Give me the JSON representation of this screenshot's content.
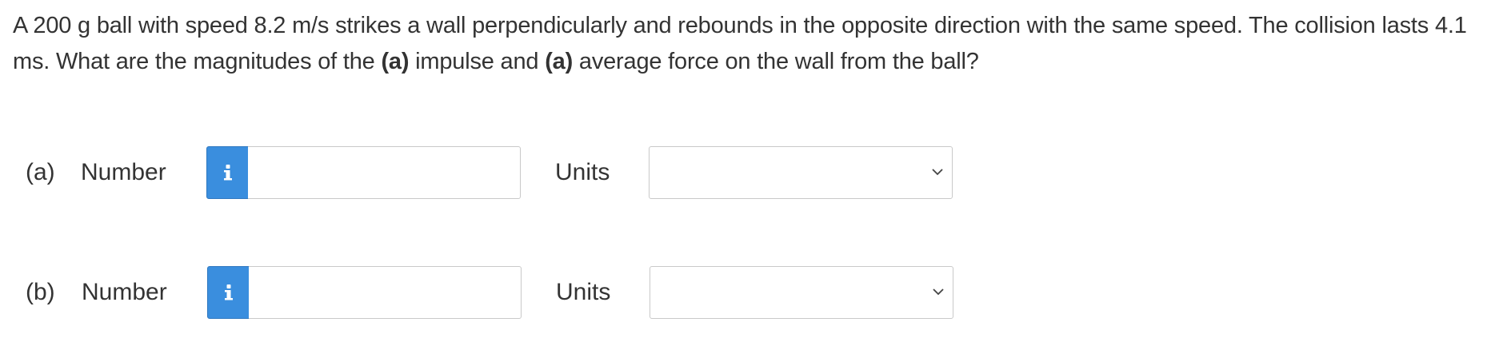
{
  "question": {
    "text_1": "A 200 g ball with speed 8.2 m/s strikes a wall perpendicularly and rebounds in the opposite direction with the same speed. The collision lasts 4.1 ms. What are the magnitudes of the ",
    "bold_1": "(a)",
    "text_2": " impulse and ",
    "bold_2": "(a)",
    "text_3": " average force on the wall from the ball?"
  },
  "parts": [
    {
      "label": "(a)",
      "number_label": "Number",
      "info_icon": "info-icon",
      "number_value": "",
      "units_label": "Units",
      "units_selected": ""
    },
    {
      "label": "(b)",
      "number_label": "Number",
      "info_icon": "info-icon",
      "number_value": "",
      "units_label": "Units",
      "units_selected": ""
    }
  ],
  "colors": {
    "info_button": "#3a8ede",
    "text": "#333333",
    "border": "#c9c9c9"
  }
}
